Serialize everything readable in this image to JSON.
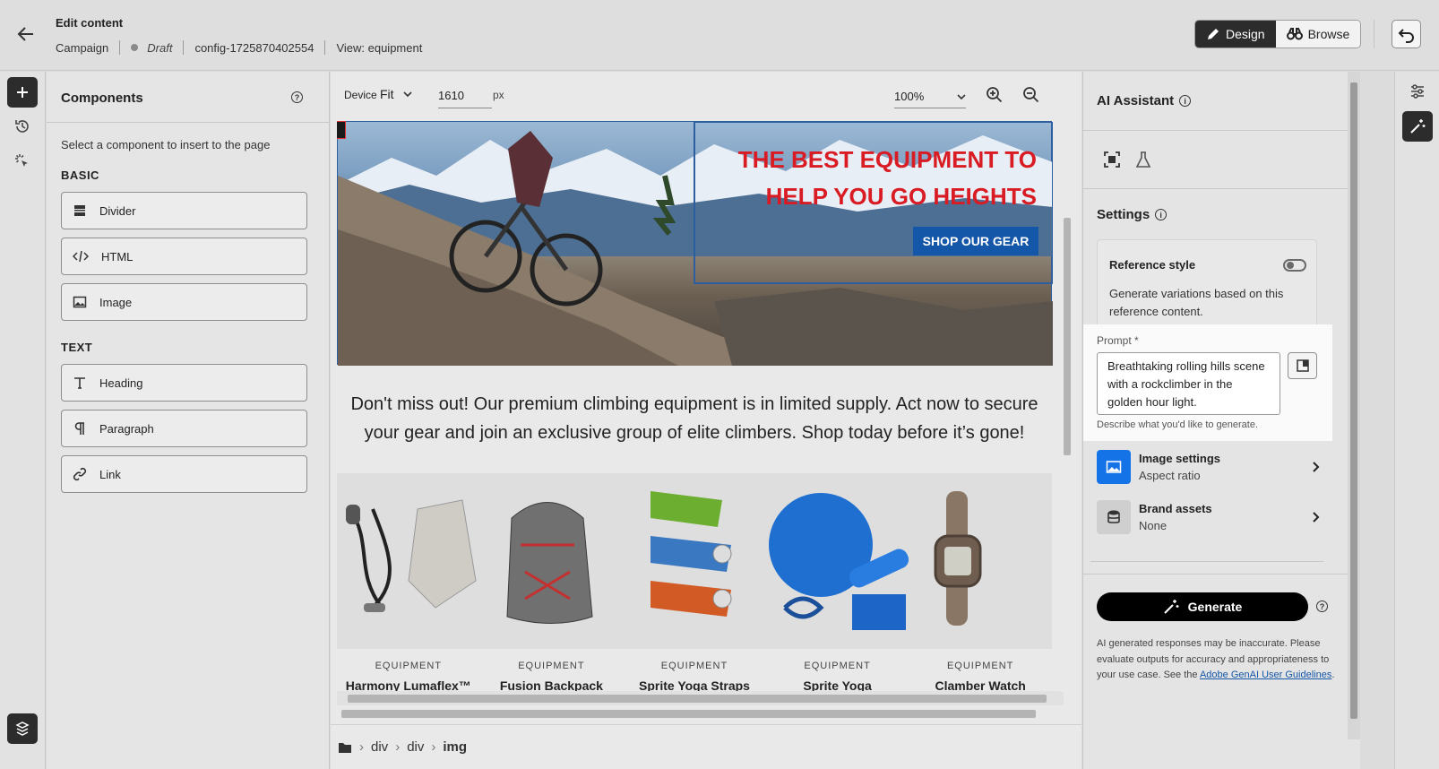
{
  "header": {
    "title": "Edit content",
    "campaign": "Campaign",
    "status": "Draft",
    "config": "config-1725870402554",
    "view": "View: equipment",
    "design_label": "Design",
    "browse_label": "Browse"
  },
  "components": {
    "title": "Components",
    "hint": "Select a component to insert to the page",
    "basic_label": "BASIC",
    "text_label": "TEXT",
    "basic_items": [
      "Divider",
      "HTML",
      "Image"
    ],
    "text_items": [
      "Heading",
      "Paragraph",
      "Link"
    ]
  },
  "canvas_toolbar": {
    "device_label": "Device",
    "device_value": "Fit",
    "width_value": "1610",
    "width_unit": "px",
    "zoom_value": "100%"
  },
  "email": {
    "hero_line1": "THE BEST EQUIPMENT TO",
    "hero_line2": "HELP YOU GO HEIGHTS",
    "hero_cta": "SHOP OUR GEAR",
    "body_text": "Don't miss out! Our premium climbing equipment is in limited supply. Act now to secure your gear and join an exclusive group of elite climbers. Shop today before it’s gone!",
    "products": [
      {
        "category": "EQUIPMENT",
        "name": "Harmony Lumaflex™"
      },
      {
        "category": "EQUIPMENT",
        "name": "Fusion Backpack"
      },
      {
        "category": "EQUIPMENT",
        "name": "Sprite Yoga Straps"
      },
      {
        "category": "EQUIPMENT",
        "name": "Sprite Yoga"
      },
      {
        "category": "EQUIPMENT",
        "name": "Clamber Watch"
      }
    ]
  },
  "breadcrumb": [
    "div",
    "div",
    "img"
  ],
  "ai_panel": {
    "title": "AI Assistant",
    "settings_title": "Settings",
    "ref_title": "Reference style",
    "ref_desc": "Generate variations based on this reference content.",
    "prompt_label": "Prompt",
    "prompt_required": "*",
    "prompt_value": "Breathtaking rolling hills scene with a rockclimber in the  golden hour light.",
    "prompt_help": "Describe what you'd like to generate.",
    "image_settings_title": "Image settings",
    "image_settings_sub": "Aspect ratio",
    "brand_title": "Brand assets",
    "brand_sub": "None",
    "generate_label": "Generate",
    "disclaimer": "AI generated responses may be inaccurate. Please evaluate outputs for accuracy and appropriateness to your use case. See the ",
    "disclaimer_link": "Adobe GenAI User Guidelines",
    "disclaimer_end": "."
  },
  "colors": {
    "hero_text": "#d91c24",
    "cta_bg": "#1456a8",
    "accent_blue": "#1473e6"
  }
}
